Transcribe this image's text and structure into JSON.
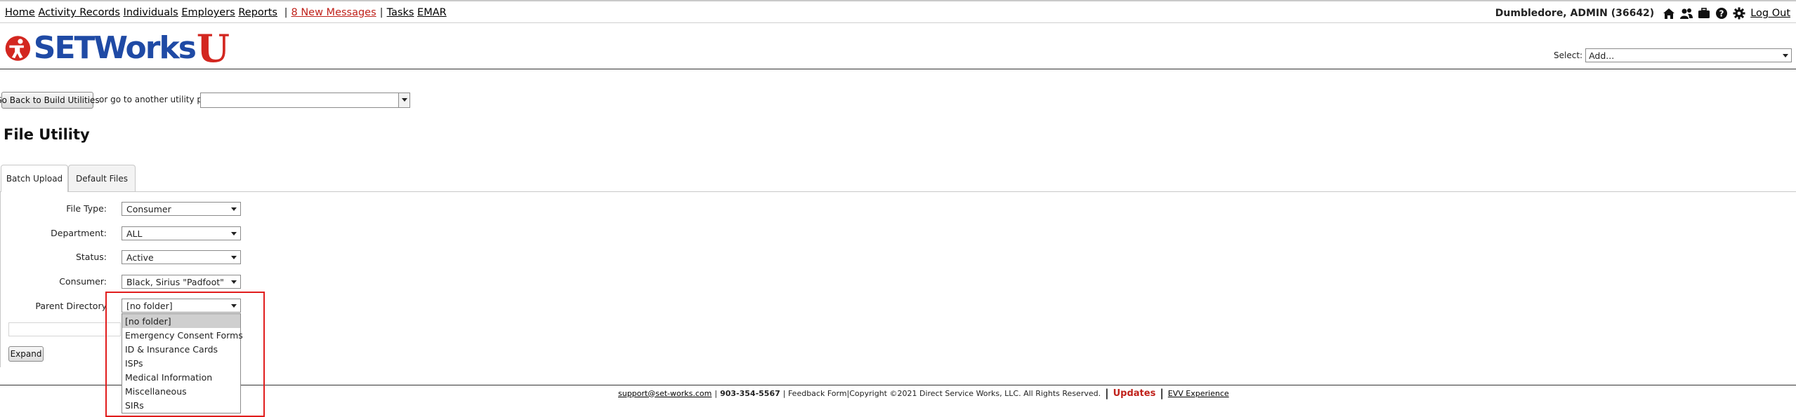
{
  "nav": {
    "home": "Home",
    "activity_records": "Activity Records",
    "individuals": "Individuals",
    "employers": "Employers",
    "reports": "Reports",
    "sep": "|",
    "messages": "8 New Messages",
    "tasks": "Tasks",
    "emar": "EMAR"
  },
  "user": {
    "name": "Dumbledore, ADMIN (36642)",
    "logout": "Log Out",
    "icons": [
      "home-icon",
      "users-icon",
      "briefcase-icon",
      "help-icon",
      "gear-icon"
    ]
  },
  "logo": {
    "text": "SETWorks",
    "accent": "U"
  },
  "header_select": {
    "label": "Select:",
    "value": "Add..."
  },
  "utility": {
    "back_button": "Go Back to Build Utilities",
    "goto_text": "or go to another utility page:",
    "goto_value": ""
  },
  "page": {
    "title": "File Utility"
  },
  "tabs": [
    {
      "label": "Batch Upload",
      "active": true
    },
    {
      "label": "Default Files",
      "active": false
    }
  ],
  "form": {
    "file_type": {
      "label": "File Type:",
      "value": "Consumer"
    },
    "department": {
      "label": "Department:",
      "value": "ALL"
    },
    "status": {
      "label": "Status:",
      "value": "Active"
    },
    "consumer": {
      "label": "Consumer:",
      "value": "Black, Sirius \"Padfoot\""
    },
    "parent_directory": {
      "label": "Parent Directory",
      "value": "[no folder]",
      "options": [
        "[no folder]",
        "Emergency Consent Forms",
        "ID & Insurance Cards",
        "ISPs",
        "Medical Information",
        "Miscellaneous",
        "SIRs"
      ]
    },
    "expand_button": "Expand"
  },
  "footer": {
    "email": "support@set-works.com",
    "sep": "|",
    "phone": "903-354-5567",
    "rest": "| Feedback Form|Copyright ©2021 Direct Service Works, LLC. All Rights Reserved.",
    "bar": "|",
    "updates": "Updates",
    "evv": "EVV Experience"
  },
  "colors": {
    "brand_blue": "#1f4aa5",
    "brand_red": "#d32720",
    "highlight": "#e11d1d"
  }
}
